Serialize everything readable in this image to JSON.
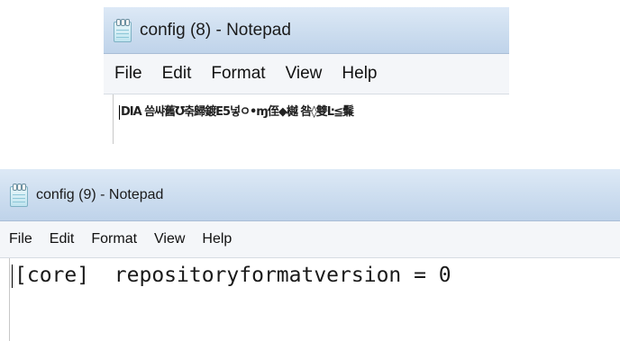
{
  "window1": {
    "title": "config (8) - Notepad",
    "menu": [
      "File",
      "Edit",
      "Format",
      "View",
      "Help"
    ],
    "content": "DIA 씀쌰舊Ʊ춖歸鍍E5넣ㅇ•ɱ侄◆樾 咎◊雙Ŀ≦鬑"
  },
  "window2": {
    "title": "config (9) - Notepad",
    "menu": [
      "File",
      "Edit",
      "Format",
      "View",
      "Help"
    ],
    "content": "[core]  repositoryformatversion = 0"
  }
}
